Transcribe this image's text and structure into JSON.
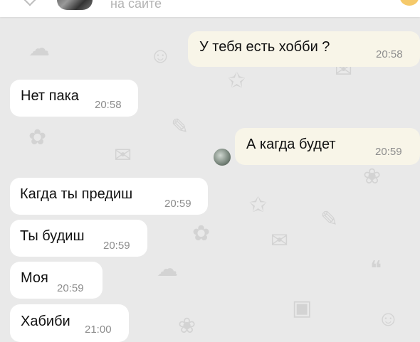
{
  "header": {
    "status": "на сайте",
    "back_icon": "chevron-left-icon",
    "menu_icon": "menu-icon"
  },
  "colors": {
    "background": "#e9e9e9",
    "incoming_bubble": "#ffffff",
    "outgoing_bubble": "#f8f5e8",
    "time_text": "#8d8d8d"
  },
  "messages": [
    {
      "direction": "out",
      "text": "У тебя есть хобби ?",
      "time": "20:58"
    },
    {
      "direction": "in",
      "text": "Нет пака",
      "time": "20:58"
    },
    {
      "direction": "out",
      "text": "А кагда будет",
      "time": "20:59"
    },
    {
      "direction": "in",
      "text": "Кагда ты предиш",
      "time": "20:59"
    },
    {
      "direction": "in",
      "text": "Ты будиш",
      "time": "20:59"
    },
    {
      "direction": "in",
      "text": "Моя",
      "time": "20:59"
    },
    {
      "direction": "in",
      "text": "Хабиби",
      "time": "21:00"
    }
  ]
}
